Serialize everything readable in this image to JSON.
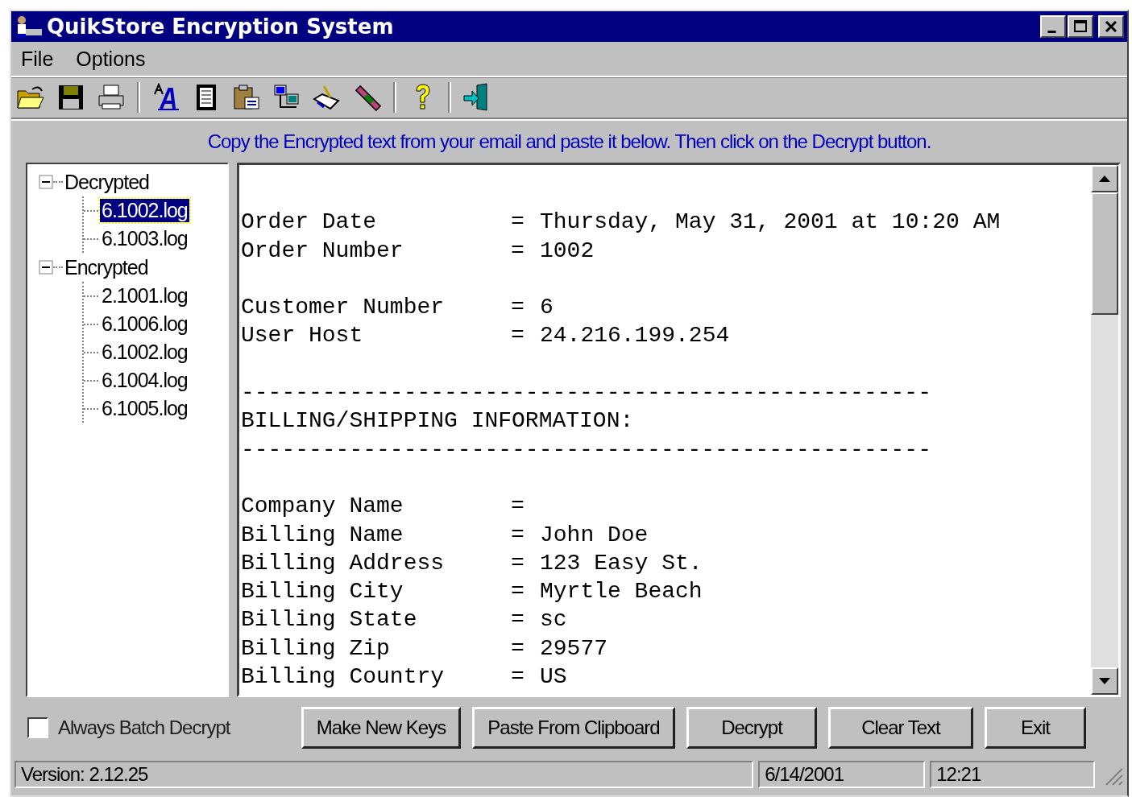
{
  "window": {
    "title": "QuikStore Encryption System"
  },
  "menu": [
    "File",
    "Options"
  ],
  "instruction": "Copy the Encrypted text from your email and paste it below. Then click on the Decrypt button.",
  "tree": [
    {
      "label": "Decrypted",
      "expanded": true,
      "children": [
        {
          "label": "6.1002.log",
          "selected": true
        },
        {
          "label": "6.1003.log",
          "selected": false
        }
      ]
    },
    {
      "label": "Encrypted",
      "expanded": true,
      "children": [
        {
          "label": "2.1001.log",
          "selected": false
        },
        {
          "label": "6.1006.log",
          "selected": false
        },
        {
          "label": "6.1002.log",
          "selected": false
        },
        {
          "label": "6.1004.log",
          "selected": false
        },
        {
          "label": "6.1005.log",
          "selected": false
        }
      ]
    }
  ],
  "text_lines": [
    {
      "kind": "gap"
    },
    {
      "kind": "field",
      "label": "Order Date",
      "sign": "=",
      "value": "Thursday, May 31, 2001 at 10:20 AM"
    },
    {
      "kind": "field",
      "label": "Order Number",
      "sign": "=",
      "value": "1002"
    },
    {
      "kind": "gap"
    },
    {
      "kind": "field",
      "label": "Customer Number",
      "sign": "=",
      "value": "6"
    },
    {
      "kind": "field",
      "label": "User Host",
      "sign": "=",
      "value": "24.216.199.254"
    },
    {
      "kind": "gap"
    },
    {
      "kind": "line",
      "text": "---------------------------------------------------"
    },
    {
      "kind": "line",
      "text": "BILLING/SHIPPING INFORMATION:"
    },
    {
      "kind": "line",
      "text": "---------------------------------------------------"
    },
    {
      "kind": "gap"
    },
    {
      "kind": "field",
      "label": "Company Name",
      "sign": "="
    },
    {
      "kind": "field",
      "label": "Billing Name",
      "sign": "=",
      "value": "John Doe"
    },
    {
      "kind": "field",
      "label": "Billing Address",
      "sign": "=",
      "value": "123 Easy St."
    },
    {
      "kind": "field",
      "label": "Billing City",
      "sign": "=",
      "value": "Myrtle Beach"
    },
    {
      "kind": "field",
      "label": "Billing State",
      "sign": "=",
      "value": "sc"
    },
    {
      "kind": "field",
      "label": "Billing Zip",
      "sign": "=",
      "value": "29577"
    },
    {
      "kind": "field",
      "label": "Billing Country",
      "sign": "=",
      "value": "US"
    }
  ],
  "batch": {
    "label": "Always Batch Decrypt",
    "checked": false
  },
  "buttons": [
    "Make New Keys",
    "Paste From Clipboard",
    "Decrypt",
    "Clear Text",
    "Exit"
  ],
  "status_bar": [
    "Version: 2.12.25",
    "6/14/2001",
    "12:21"
  ]
}
